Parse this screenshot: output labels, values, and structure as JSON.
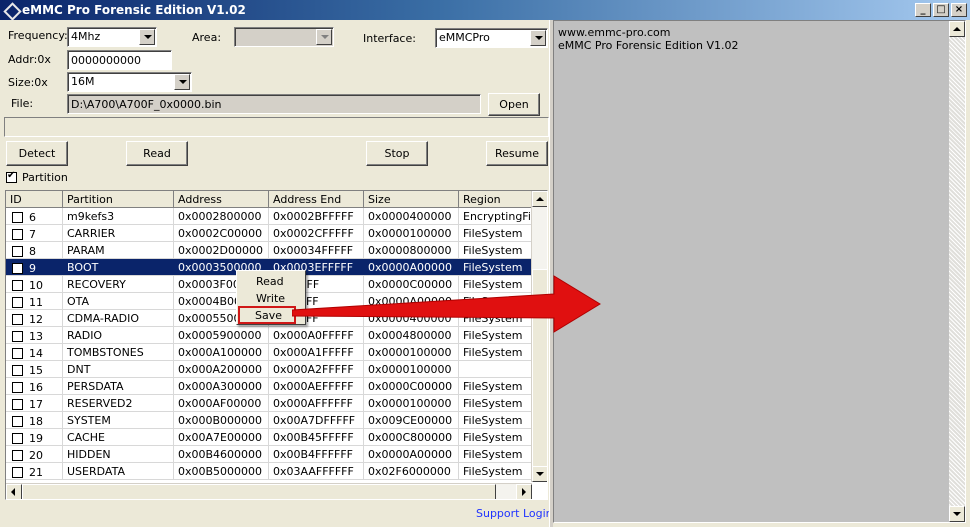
{
  "window": {
    "title": "eMMC Pro Forensic Edition V1.02",
    "btn_min": "_",
    "btn_max": "□",
    "btn_close": "×"
  },
  "form": {
    "frequency_label": "Frequency:",
    "frequency_value": "4Mhz",
    "area_label": "Area:",
    "area_value": "",
    "interface_label": "Interface:",
    "interface_value": "eMMCPro",
    "addr_label": "Addr:0x",
    "addr_value": "0000000000",
    "size_label": "Size:0x",
    "size_value": "16M",
    "file_label": "File:",
    "file_value": "D:\\A700\\A700F_0x0000.bin",
    "open_label": "Open"
  },
  "buttons": {
    "detect": "Detect",
    "read": "Read",
    "stop": "Stop",
    "resume": "Resume"
  },
  "partition_checkbox_label": "Partition",
  "table": {
    "columns": [
      "ID",
      "Partition",
      "Address",
      "Address End",
      "Size",
      "Region"
    ],
    "rows": [
      {
        "id": "6",
        "partition": "m9kefs3",
        "address": "0x0002800000",
        "address_end": "0x0002BFFFFF",
        "size": "0x0000400000",
        "region": "EncryptingFile"
      },
      {
        "id": "7",
        "partition": "CARRIER",
        "address": "0x0002C00000",
        "address_end": "0x0002CFFFFF",
        "size": "0x0000100000",
        "region": "FileSystem"
      },
      {
        "id": "8",
        "partition": "PARAM",
        "address": "0x0002D00000",
        "address_end": "0x00034FFFFF",
        "size": "0x0000800000",
        "region": "FileSystem"
      },
      {
        "id": "9",
        "partition": "BOOT",
        "address": "0x0003500000",
        "address_end": "0x0003EFFFFF",
        "size": "0x0000A00000",
        "region": "FileSystem"
      },
      {
        "id": "10",
        "partition": "RECOVERY",
        "address": "0x0003F000",
        "address_end": "4AFFFFF",
        "size": "0x0000C00000",
        "region": "FileSystem"
      },
      {
        "id": "11",
        "partition": "OTA",
        "address": "0x0004B000",
        "address_end": "54FFFFF",
        "size": "0x0000A00000",
        "region": "FileSystem"
      },
      {
        "id": "12",
        "partition": "CDMA-RADIO",
        "address": "0x00055000",
        "address_end": "58FFFFF",
        "size": "0x0000400000",
        "region": "FileSystem"
      },
      {
        "id": "13",
        "partition": "RADIO",
        "address": "0x0005900000",
        "address_end": "0x000A0FFFFF",
        "size": "0x0004800000",
        "region": "FileSystem"
      },
      {
        "id": "14",
        "partition": "TOMBSTONES",
        "address": "0x000A100000",
        "address_end": "0x000A1FFFFF",
        "size": "0x0000100000",
        "region": "FileSystem"
      },
      {
        "id": "15",
        "partition": "DNT",
        "address": "0x000A200000",
        "address_end": "0x000A2FFFFF",
        "size": "0x0000100000",
        "region": ""
      },
      {
        "id": "16",
        "partition": "PERSDATA",
        "address": "0x000A300000",
        "address_end": "0x000AEFFFFF",
        "size": "0x0000C00000",
        "region": "FileSystem"
      },
      {
        "id": "17",
        "partition": "RESERVED2",
        "address": "0x000AF00000",
        "address_end": "0x000AFFFFFF",
        "size": "0x0000100000",
        "region": "FileSystem"
      },
      {
        "id": "18",
        "partition": "SYSTEM",
        "address": "0x000B000000",
        "address_end": "0x00A7DFFFFF",
        "size": "0x009CE00000",
        "region": "FileSystem"
      },
      {
        "id": "19",
        "partition": "CACHE",
        "address": "0x00A7E00000",
        "address_end": "0x00B45FFFFF",
        "size": "0x000C800000",
        "region": "FileSystem"
      },
      {
        "id": "20",
        "partition": "HIDDEN",
        "address": "0x00B4600000",
        "address_end": "0x00B4FFFFFF",
        "size": "0x0000A00000",
        "region": "FileSystem"
      },
      {
        "id": "21",
        "partition": "USERDATA",
        "address": "0x00B5000000",
        "address_end": "0x03AAFFFFFF",
        "size": "0x02F6000000",
        "region": "FileSystem"
      }
    ],
    "selected_row_id": "9"
  },
  "context_menu": {
    "items": [
      "Read",
      "Write",
      "Save"
    ],
    "highlighted": "Save"
  },
  "support_link": "Support Login",
  "log": {
    "lines": [
      "www.emmc-pro.com",
      "eMMC Pro Forensic Edition V1.02"
    ]
  },
  "colors": {
    "selection": "#0a246a",
    "annotation_red": "#e01010",
    "link": "#1f33ff"
  }
}
